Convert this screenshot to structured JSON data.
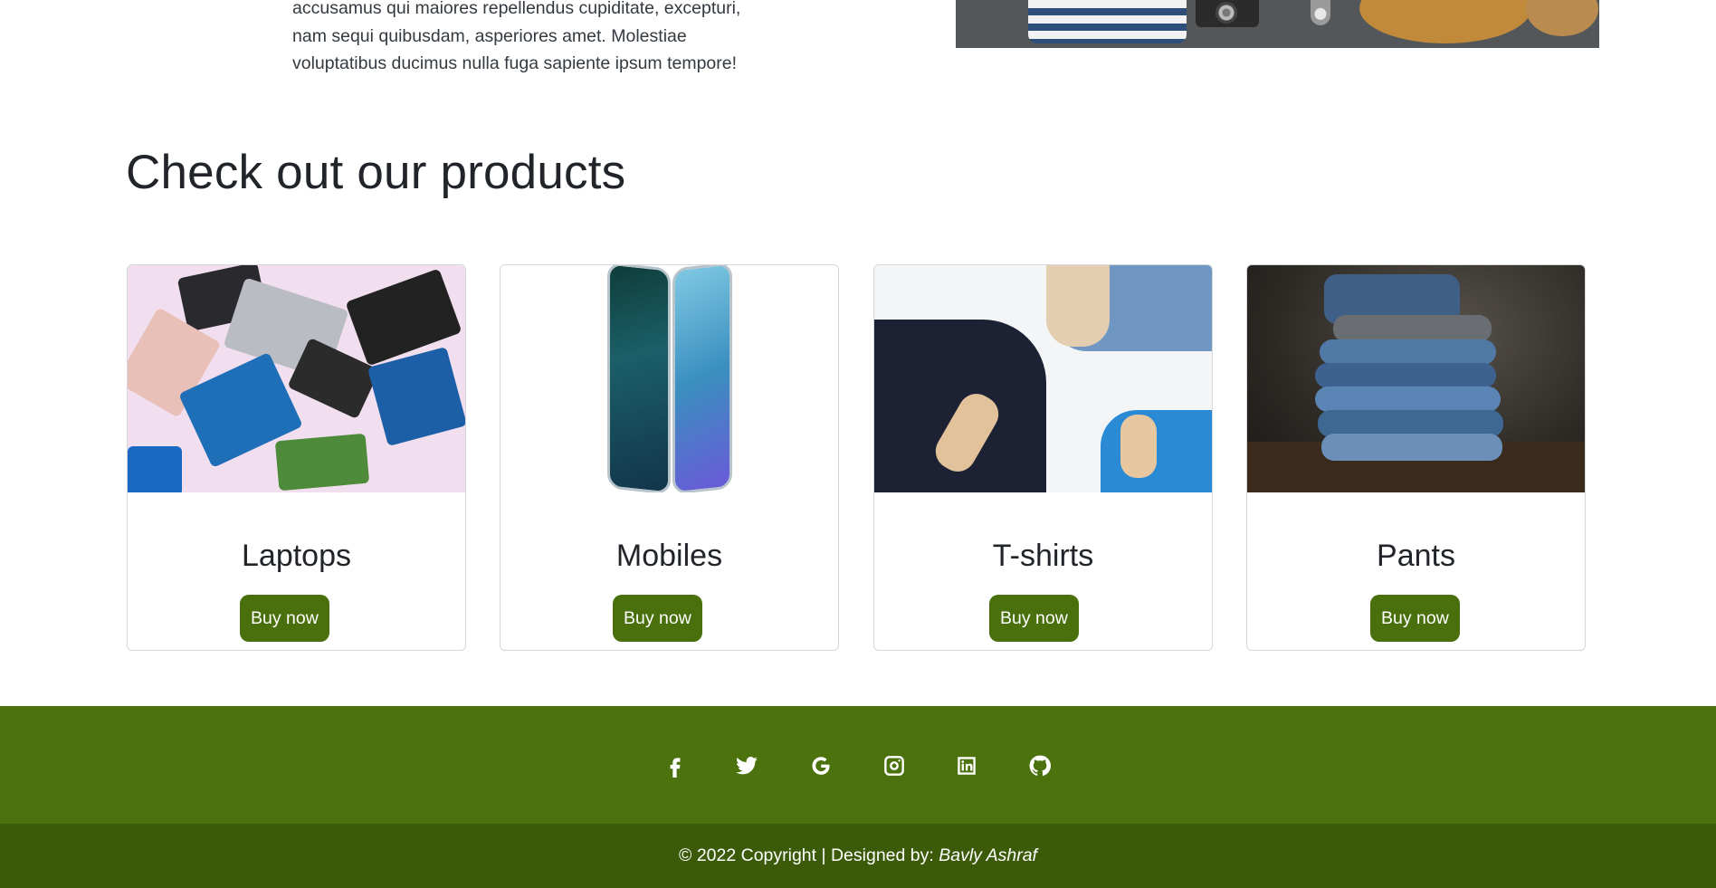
{
  "about": {
    "text": "accusamus qui maiores repellendus cupiditate, excepturi, nam sequi quibusdam, asperiores amet. Molestiae voluptatibus ducimus nulla fuga sapiente ipsum tempore!"
  },
  "products": {
    "heading": "Check out our products",
    "items": [
      {
        "title": "Laptops",
        "button": "Buy now"
      },
      {
        "title": "Mobiles",
        "button": "Buy now"
      },
      {
        "title": "T-shirts",
        "button": "Buy now"
      },
      {
        "title": "Pants",
        "button": "Buy now"
      }
    ]
  },
  "footer": {
    "social_icons": [
      "facebook-icon",
      "twitter-icon",
      "google-icon",
      "instagram-icon",
      "linkedin-icon",
      "github-icon"
    ],
    "copyright": "© 2022 Copyright | Designed by: ",
    "designer": "Bavly Ashraf"
  },
  "colors": {
    "accent": "#4a6f0d",
    "footer_top": "#4b720d",
    "footer_bottom": "#3b5b0a"
  }
}
